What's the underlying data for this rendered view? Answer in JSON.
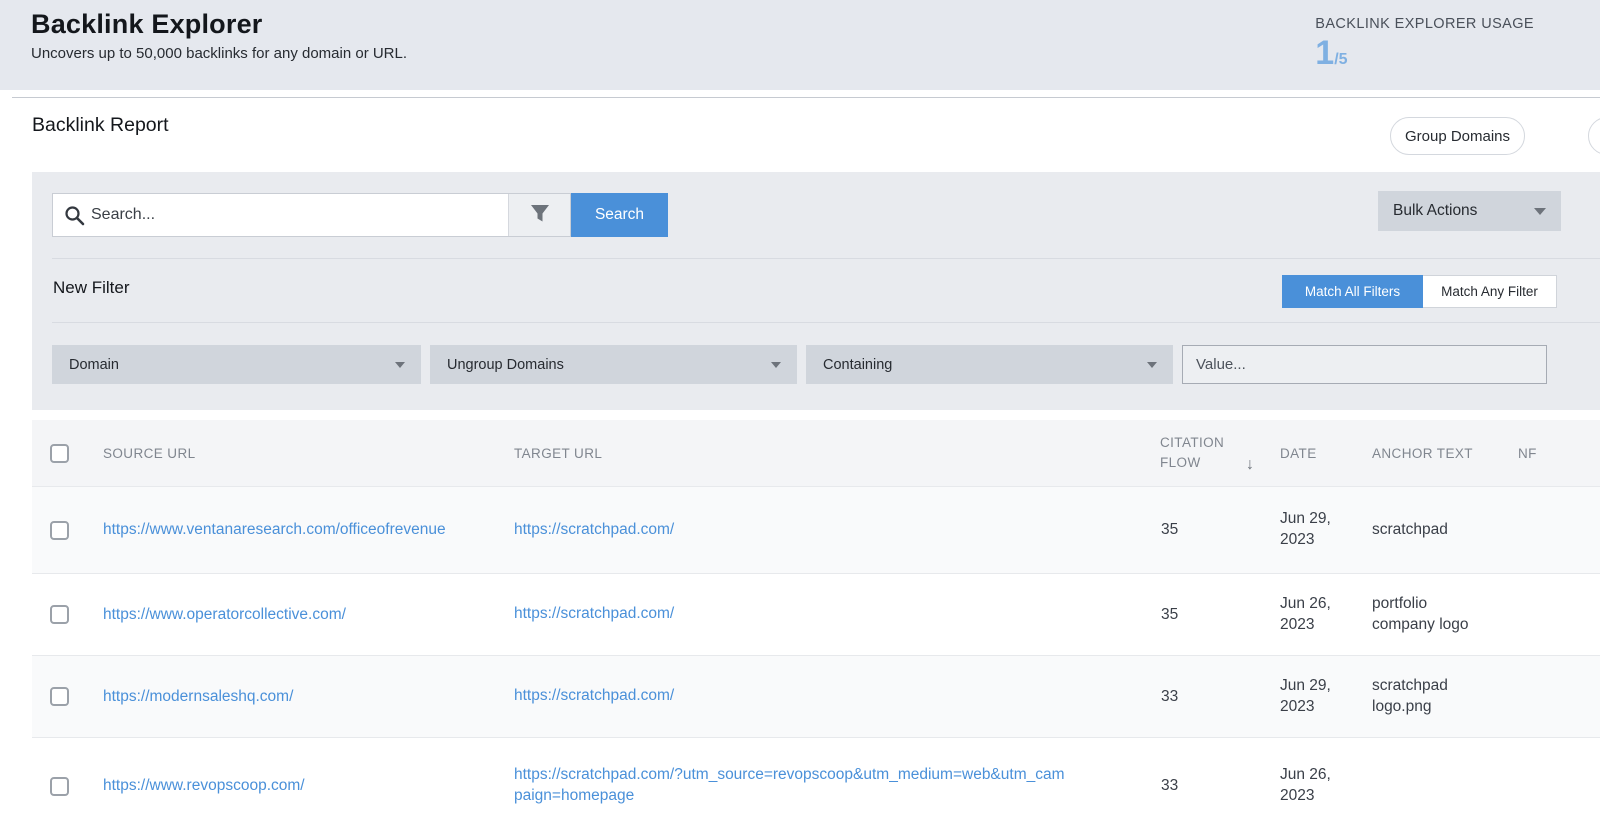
{
  "app_header": {
    "title": "Backlink Explorer",
    "subtitle": "Uncovers up to 50,000 backlinks for any domain or URL.",
    "usage_label": "BACKLINK EXPLORER USAGE",
    "usage_current": "1",
    "usage_total": "/5"
  },
  "report": {
    "title": "Backlink Report",
    "group_domains_label": "Group Domains"
  },
  "toolbar": {
    "search_placeholder": "Search...",
    "search_button_label": "Search",
    "bulk_actions_label": "Bulk Actions"
  },
  "filter": {
    "title": "New Filter",
    "match_all_label": "Match All Filters",
    "match_any_label": "Match Any Filter",
    "field_dropdown_value": "Domain",
    "group_dropdown_value": "Ungroup Domains",
    "operator_dropdown_value": "Containing",
    "value_placeholder": "Value..."
  },
  "table": {
    "headers": {
      "source": "SOURCE URL",
      "target": "TARGET URL",
      "citation_flow": "CITATION FLOW",
      "sort_arrow": "↓",
      "date": "DATE",
      "anchor": "ANCHOR TEXT",
      "nf": "NF"
    },
    "rows": [
      {
        "source": "https://www.ventanaresearch.com/officeofrevenue",
        "target": "https://scratchpad.com/",
        "citation_flow": "35",
        "date": "Jun 29, 2023",
        "anchor_text": "scratchpad"
      },
      {
        "source": "https://www.operatorcollective.com/",
        "target": "https://scratchpad.com/",
        "citation_flow": "35",
        "date": "Jun 26, 2023",
        "anchor_text": "portfolio company logo"
      },
      {
        "source": "https://modernsaleshq.com/",
        "target": "https://scratchpad.com/",
        "citation_flow": "33",
        "date": "Jun 29, 2023",
        "anchor_text": "scratchpad logo.png"
      },
      {
        "source": "https://www.revopscoop.com/",
        "target": "https://scratchpad.com/?utm_source=revopscoop&utm_medium=web&utm_campaign=homepage",
        "citation_flow": "33",
        "date": "Jun 26, 2023",
        "anchor_text": ""
      }
    ]
  },
  "icons": {
    "search": "magnifier-icon",
    "filter": "funnel-icon",
    "dropdown": "chevron-down-icon"
  },
  "colors": {
    "accent_blue": "#4a90d9",
    "usage_blue": "#7fb0e2",
    "header_bg": "#e5e8ee",
    "panel_bg": "#e9ebef",
    "dropdown_bg": "#d0d5dc",
    "link_blue": "#4a90d9"
  }
}
